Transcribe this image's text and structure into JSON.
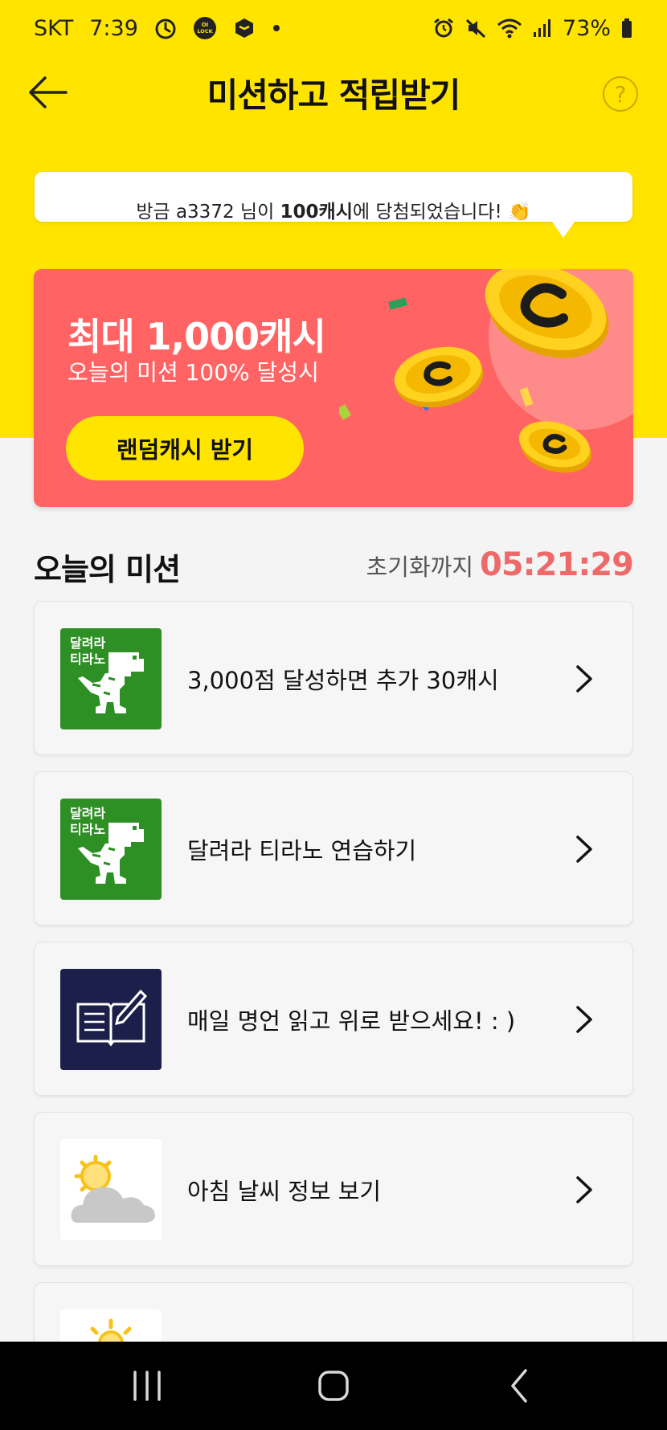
{
  "status_bar": {
    "carrier": "SKT",
    "time": "7:39",
    "lock_badge": "OI LOCK",
    "battery": "73%"
  },
  "header": {
    "title": "미션하고 적립받기",
    "help_symbol": "?"
  },
  "ticker": {
    "prefix": "방금 a3372",
    "middle": "님이 ",
    "highlight": "100캐시",
    "suffix": "에 당첨되었습니다! 👏"
  },
  "banner": {
    "title": "최대 1,000캐시",
    "subtitle": "오늘의 미션 100% 달성시",
    "button_label": "랜덤캐시 받기",
    "background": "#ff6363"
  },
  "section": {
    "title": "오늘의 미션",
    "reset_label": "초기화까지",
    "reset_time": "05:21:29"
  },
  "missions": [
    {
      "label": "3,000점 달성하면 추가 30캐시",
      "thumb_icon": "dino-game-icon",
      "thumb_text": [
        "달려라",
        "티라노"
      ]
    },
    {
      "label": "달려라 티라노 연습하기",
      "thumb_icon": "dino-game-icon",
      "thumb_text": [
        "달려라",
        "티라노"
      ]
    },
    {
      "label": "매일 명언 읽고 위로 받으세요! : )",
      "thumb_icon": "book-pen-icon"
    },
    {
      "label": "아침 날씨 정보 보기",
      "thumb_icon": "sun-cloud-icon"
    }
  ],
  "colors": {
    "brand_yellow": "#ffe400",
    "banner_red": "#ff6363",
    "timer_red": "#ee6a6a",
    "dino_green": "#2e8f24"
  }
}
